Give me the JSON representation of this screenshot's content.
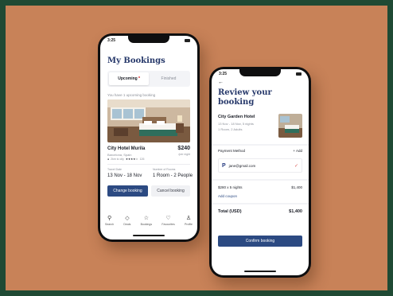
{
  "colors": {
    "background": "#c88258",
    "frame": "#1f4a34",
    "primary": "#2c4a82",
    "title": "#26386a"
  },
  "left_phone": {
    "status_time": "3:25",
    "title": "My Bookings",
    "tabs": [
      {
        "label": "Upcoming",
        "active": true
      },
      {
        "label": "Finished",
        "active": false
      }
    ],
    "info": "You have 1 upcoming booking",
    "hotel": {
      "name": "City Hotel Murila",
      "location": "Barcelona, Spain",
      "distance": "2km to city",
      "stars": "★★★★☆",
      "reviews": "126",
      "price": "$240",
      "price_unit": "/per night"
    },
    "travel_date_label": "Travel Date",
    "travel_date_value": "13 Nov - 18 Nov",
    "rooms_label": "Number of Rooms",
    "rooms_value": "1 Room - 2 People",
    "change_button": "Change booking",
    "cancel_button": "Cancel booking",
    "nav": [
      {
        "label": "Search",
        "icon": "search-icon"
      },
      {
        "label": "Deals",
        "icon": "tag-icon"
      },
      {
        "label": "Bookings",
        "icon": "star-icon"
      },
      {
        "label": "Favourites",
        "icon": "heart-icon"
      },
      {
        "label": "Profile",
        "icon": "profile-icon"
      }
    ]
  },
  "right_phone": {
    "status_time": "3:25",
    "back_arrow": "←",
    "title_line1": "Review your",
    "title_line2": "booking",
    "hotel_name": "City Garden Hotel",
    "dates": "13 Nov - 18 Nov, 5 nights",
    "rooms": "1 Room, 2 Adults",
    "payment_label": "Payment Method",
    "add_label": "+ Add",
    "email": "jane@gmail.com",
    "line_item": "$280 x 5 nights",
    "line_amount": "$1,400",
    "coupon": "Add coupon",
    "total_label": "Total (USD)",
    "total_amount": "$1,400",
    "confirm_button": "Confirm booking"
  }
}
